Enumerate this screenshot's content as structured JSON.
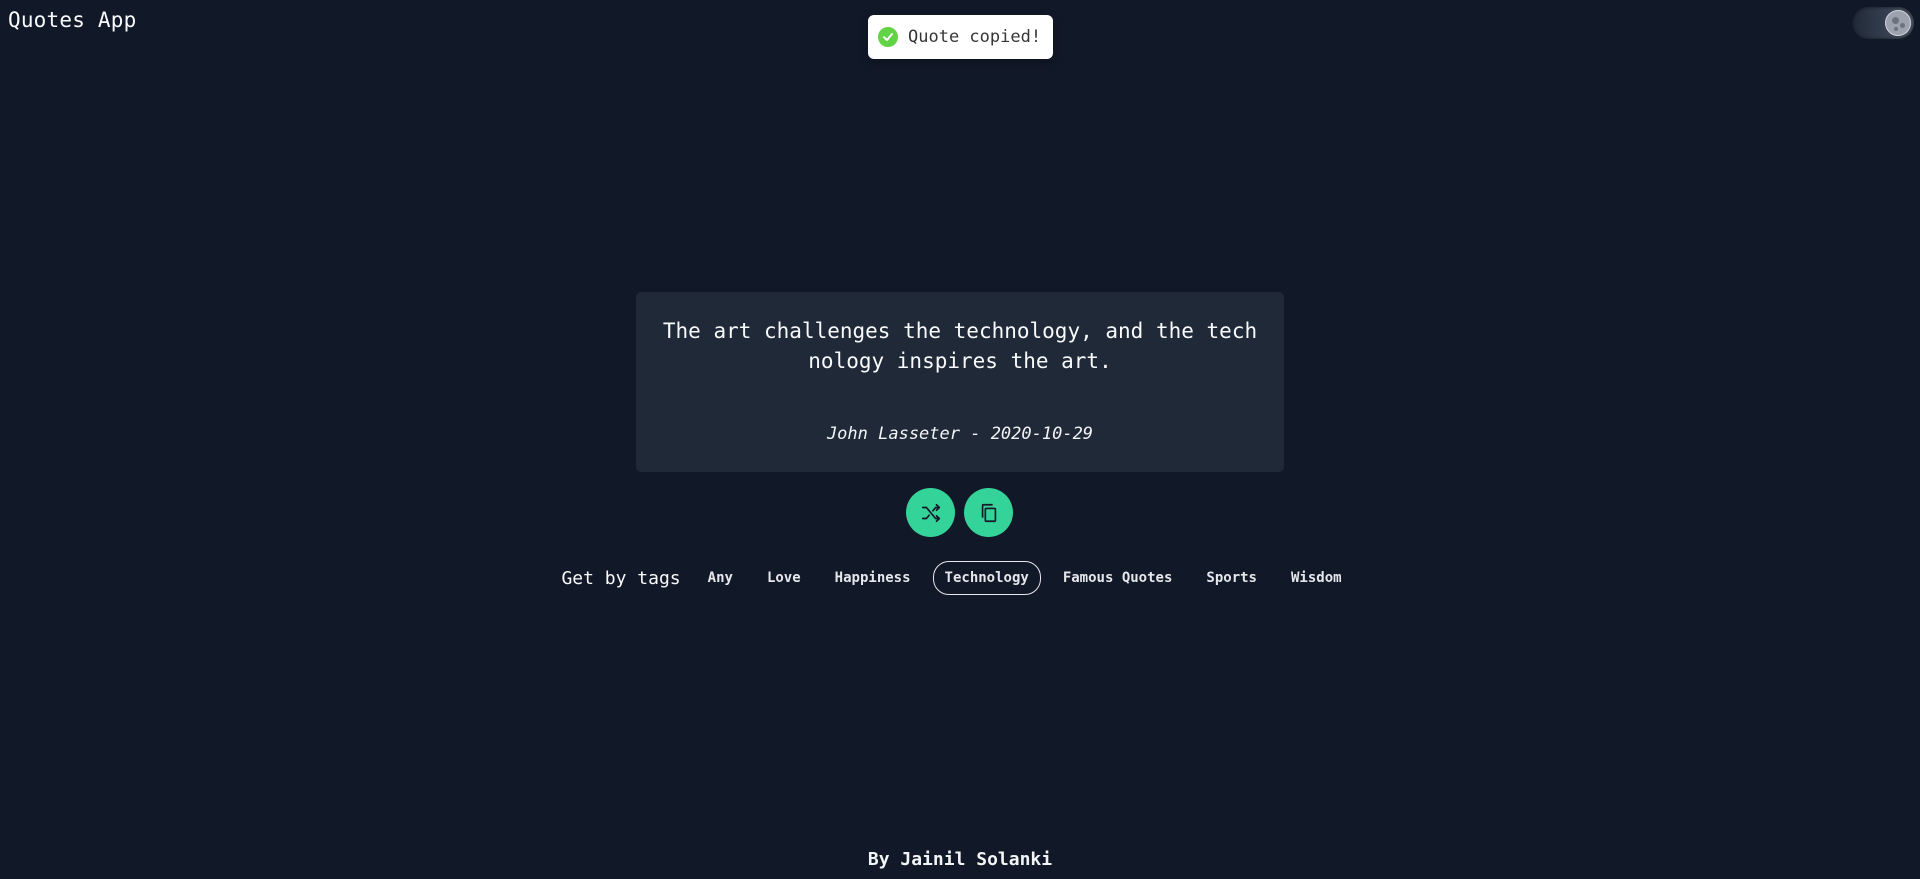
{
  "header": {
    "title": "Quotes App"
  },
  "toast": {
    "message": "Quote copied!",
    "icon": "check-circle-icon",
    "color": "#61d345"
  },
  "theme_toggle": {
    "mode": "dark",
    "icon": "moon-icon"
  },
  "quote": {
    "text": "The art challenges the technology, and the technology inspires the art.",
    "meta": "John Lasseter - 2020-10-29"
  },
  "actions": {
    "random_icon": "shuffle-icon",
    "copy_icon": "copy-icon",
    "accent": "#34d399"
  },
  "tags": {
    "label": "Get by tags",
    "items": [
      {
        "label": "Any"
      },
      {
        "label": "Love"
      },
      {
        "label": "Happiness"
      },
      {
        "label": "Technology",
        "active": true
      },
      {
        "label": "Famous Quotes"
      },
      {
        "label": "Sports"
      },
      {
        "label": "Wisdom"
      }
    ]
  },
  "footer": {
    "text": "By Jainil Solanki"
  }
}
